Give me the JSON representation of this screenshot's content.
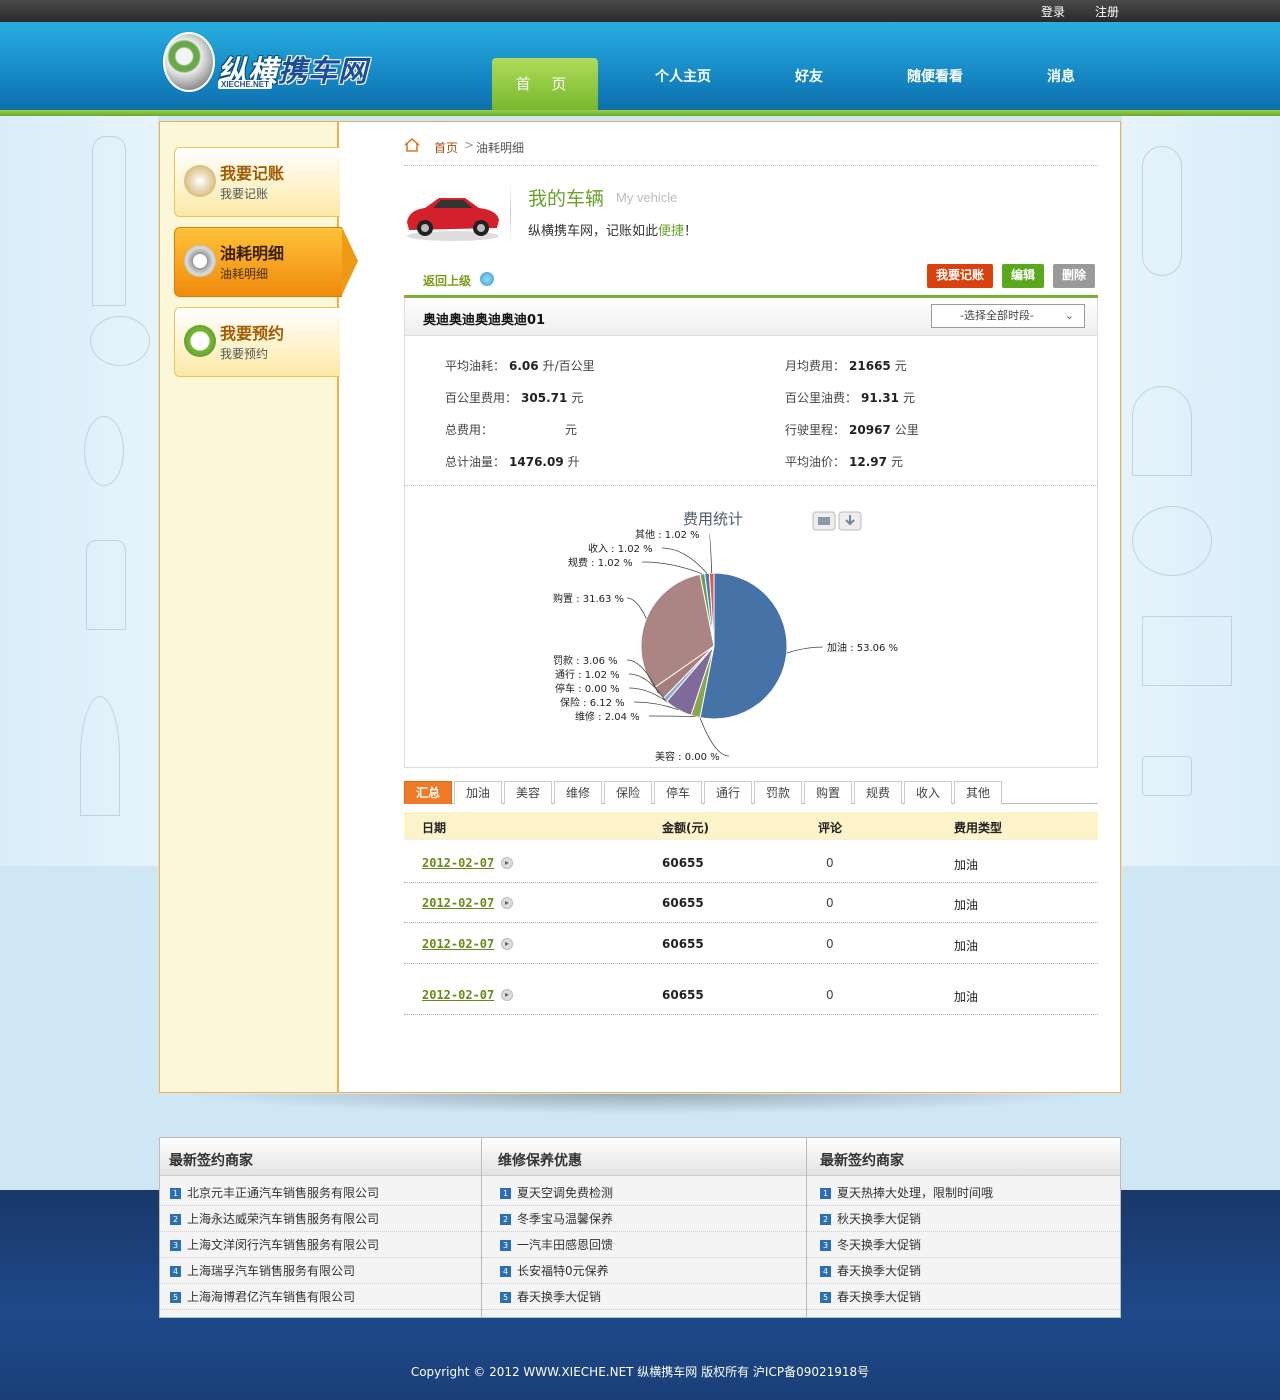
{
  "topbar": {
    "login": "登录",
    "register": "注册"
  },
  "header": {
    "logo_cn_a": "纵横",
    "logo_cn_b": "携车网",
    "logo_en": "XIECHE.NET"
  },
  "nav": {
    "home": "首 页",
    "items": [
      "个人主页",
      "好友",
      "随便看看",
      "消息"
    ]
  },
  "sidebar": {
    "items": [
      {
        "title": "我要记账",
        "sub": "我要记账",
        "icon": "notepad-icon"
      },
      {
        "title": "油耗明细",
        "sub": "油耗明细",
        "icon": "gauge-icon",
        "active": true
      },
      {
        "title": "我要预约",
        "sub": "我要预约",
        "icon": "clock-icon"
      }
    ]
  },
  "breadcrumb": {
    "home": "首页",
    "sep": ">",
    "current": "油耗明细"
  },
  "vehicle": {
    "title": "我的车辆",
    "title_en": "My vehicle",
    "sub_pre": "纵横携车网，记账如此",
    "sub_hl": "便捷",
    "sub_post": "！"
  },
  "actions": {
    "back": "返回上级",
    "add": "我要记账",
    "edit": "编辑",
    "delete": "删除",
    "colors": {
      "add": "#d9420f",
      "edit": "#5aa81e",
      "delete": "#9a9a9a"
    }
  },
  "car": {
    "name": "奥迪奥迪奥迪奥迪01",
    "period": "-选择全部时段-"
  },
  "stats": {
    "avg_fuel_label": "平均油耗：",
    "avg_fuel": "6.06",
    "avg_fuel_unit": "升/百公里",
    "monthly_label": "月均费用：",
    "monthly": "21665",
    "monthly_unit": "元",
    "per100_cost_label": "百公里费用：",
    "per100_cost": "305.71",
    "per100_cost_unit": "元",
    "per100_fuelcost_label": "百公里油费：",
    "per100_fuelcost": "91.31",
    "per100_fuelcost_unit": "元",
    "total_cost_label": "总费用：",
    "total_cost": "",
    "total_cost_unit": "元",
    "mileage_label": "行驶里程：",
    "mileage": "20967",
    "mileage_unit": "公里",
    "total_fuel_label": "总计油量：",
    "total_fuel": "1476.09",
    "total_fuel_unit": "升",
    "avg_price_label": "平均油价：",
    "avg_price": "12.97",
    "avg_price_unit": "元"
  },
  "chart_data": {
    "type": "pie",
    "title": "费用统计",
    "labels": [
      "加油",
      "美容",
      "维修",
      "保险",
      "停车",
      "通行",
      "罚款",
      "购置",
      "规费",
      "收入",
      "其他"
    ],
    "label_texts": [
      "加油 : 53.06 %",
      "美容 : 0.00 %",
      "维修 : 2.04 %",
      "保险 : 6.12 %",
      "停车 : 0.00 %",
      "通行 : 1.02 %",
      "罚款 : 3.06 %",
      "购置 : 31.63 %",
      "规费 : 1.02 %",
      "收入 : 1.02 %",
      "其他 : 1.02 %"
    ],
    "values": [
      53.06,
      0.0,
      2.04,
      6.12,
      0.0,
      1.02,
      3.06,
      31.63,
      1.02,
      1.02,
      1.02
    ],
    "colors": [
      "#4572a7",
      "#80699b",
      "#89a54e",
      "#80699b",
      "#db843d",
      "#92a8cd",
      "#a47d7c",
      "#aa8583",
      "#6a9a5a",
      "#4a7ab0",
      "#e0584a"
    ]
  },
  "tabs": [
    "汇总",
    "加油",
    "美容",
    "维修",
    "保险",
    "停车",
    "通行",
    "罚款",
    "购置",
    "规费",
    "收入",
    "其他"
  ],
  "table": {
    "headers": [
      "日期",
      "金额(元)",
      "评论",
      "费用类型"
    ],
    "rows": [
      {
        "date": "2012-02-07",
        "amount": "60655",
        "comments": "0",
        "type": "加油"
      },
      {
        "date": "2012-02-07",
        "amount": "60655",
        "comments": "0",
        "type": "加油"
      },
      {
        "date": "2012-02-07",
        "amount": "60655",
        "comments": "0",
        "type": "加油"
      },
      {
        "date": "2012-02-07",
        "amount": "60655",
        "comments": "0",
        "type": "加油"
      }
    ]
  },
  "footer_links": [
    {
      "title": "最新签约商家",
      "items": [
        "北京元丰正通汽车销售服务有限公司",
        "上海永达威荣汽车销售服务有限公司",
        "上海文洋闵行汽车销售服务有限公司",
        "上海瑞孚汽车销售服务有限公司",
        "上海海博君亿汽车销售有限公司"
      ]
    },
    {
      "title": "维修保养优惠",
      "items": [
        "夏天空调免费检测",
        "冬季宝马温馨保养",
        "一汽丰田感恩回馈",
        "长安福特0元保养",
        "春天换季大促销"
      ]
    },
    {
      "title": "最新签约商家",
      "items": [
        "夏天热捧大处理，限制时间哦",
        "秋天换季大促销",
        "冬天换季大促销",
        "春天换季大促销",
        "春天换季大促销"
      ]
    }
  ],
  "copyright": "Copyright © 2012 WWW.XIECHE.NET  纵横携车网 版权所有   沪ICP备09021918号"
}
